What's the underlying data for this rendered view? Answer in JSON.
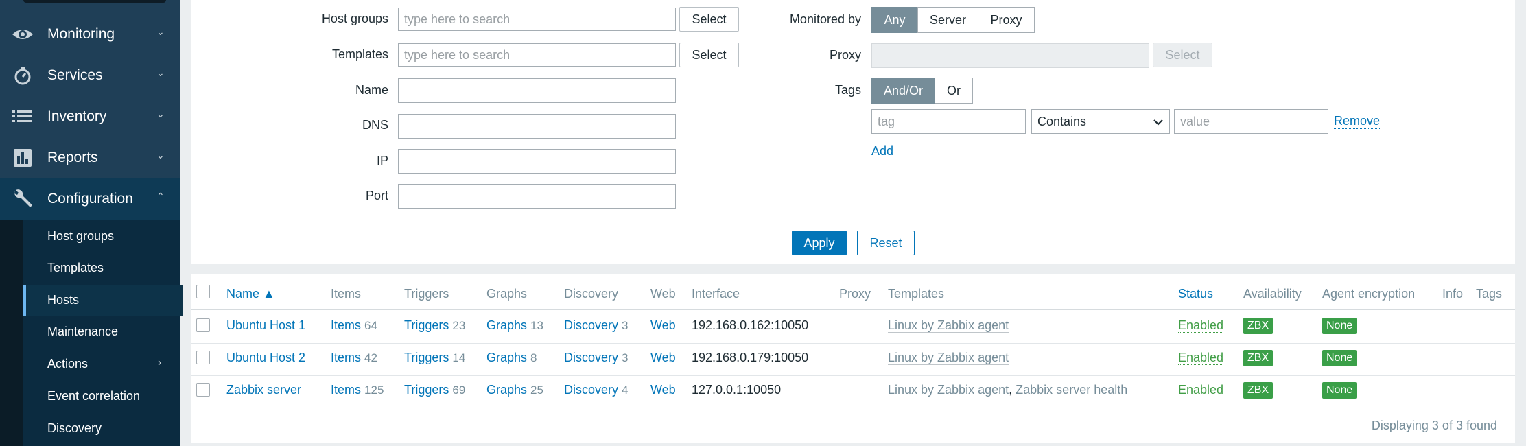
{
  "sidebar": {
    "items": [
      {
        "label": "Monitoring",
        "icon": "eye-icon",
        "chevron": "⌄"
      },
      {
        "label": "Services",
        "icon": "stopwatch-icon",
        "chevron": "⌄"
      },
      {
        "label": "Inventory",
        "icon": "list-icon",
        "chevron": "⌄"
      },
      {
        "label": "Reports",
        "icon": "bar-chart-icon",
        "chevron": "⌄"
      },
      {
        "label": "Configuration",
        "icon": "wrench-icon",
        "chevron": "⌃"
      }
    ],
    "subitems": [
      {
        "label": "Host groups"
      },
      {
        "label": "Templates"
      },
      {
        "label": "Hosts",
        "selected": true
      },
      {
        "label": "Maintenance"
      },
      {
        "label": "Actions",
        "chevron": "›"
      },
      {
        "label": "Event correlation"
      },
      {
        "label": "Discovery"
      }
    ]
  },
  "filter": {
    "host_groups": {
      "label": "Host groups",
      "placeholder": "type here to search",
      "button": "Select"
    },
    "templates": {
      "label": "Templates",
      "placeholder": "type here to search",
      "button": "Select"
    },
    "name": {
      "label": "Name",
      "value": ""
    },
    "dns": {
      "label": "DNS",
      "value": ""
    },
    "ip": {
      "label": "IP",
      "value": ""
    },
    "port": {
      "label": "Port",
      "value": ""
    },
    "monitored_by": {
      "label": "Monitored by",
      "options": [
        "Any",
        "Server",
        "Proxy"
      ],
      "selected": "Any"
    },
    "proxy": {
      "label": "Proxy",
      "button": "Select"
    },
    "tags": {
      "label": "Tags",
      "options": [
        "And/Or",
        "Or"
      ],
      "selected": "And/Or",
      "tag_placeholder": "tag",
      "operator": "Contains",
      "value_placeholder": "value",
      "remove": "Remove",
      "add": "Add"
    },
    "apply": "Apply",
    "reset": "Reset"
  },
  "table": {
    "headers": {
      "name": "Name ▲",
      "items": "Items",
      "triggers": "Triggers",
      "graphs": "Graphs",
      "discovery": "Discovery",
      "web": "Web",
      "interface": "Interface",
      "proxy": "Proxy",
      "templates": "Templates",
      "status": "Status",
      "availability": "Availability",
      "agent_encryption": "Agent encryption",
      "info": "Info",
      "tags": "Tags"
    },
    "rows": [
      {
        "name": "Ubuntu Host 1",
        "items_label": "Items",
        "items": "64",
        "triggers_label": "Triggers",
        "triggers": "23",
        "graphs_label": "Graphs",
        "graphs": "13",
        "discovery_label": "Discovery",
        "discovery": "3",
        "web": "Web",
        "interface": "192.168.0.162:10050",
        "templates": [
          "Linux by Zabbix agent"
        ],
        "status": "Enabled",
        "availability": "ZBX",
        "encryption": "None"
      },
      {
        "name": "Ubuntu Host 2",
        "items_label": "Items",
        "items": "42",
        "triggers_label": "Triggers",
        "triggers": "14",
        "graphs_label": "Graphs",
        "graphs": "8",
        "discovery_label": "Discovery",
        "discovery": "3",
        "web": "Web",
        "interface": "192.168.0.179:10050",
        "templates": [
          "Linux by Zabbix agent"
        ],
        "status": "Enabled",
        "availability": "ZBX",
        "encryption": "None"
      },
      {
        "name": "Zabbix server",
        "items_label": "Items",
        "items": "125",
        "triggers_label": "Triggers",
        "triggers": "69",
        "graphs_label": "Graphs",
        "graphs": "25",
        "discovery_label": "Discovery",
        "discovery": "4",
        "web": "Web",
        "interface": "127.0.0.1:10050",
        "templates": [
          "Linux by Zabbix agent",
          "Zabbix server health"
        ],
        "status": "Enabled",
        "availability": "ZBX",
        "encryption": "None"
      }
    ],
    "template_separator": ",",
    "footer": "Displaying 3 of 3 found"
  },
  "colors": {
    "sidebar": "#1f3f57",
    "accent": "#0275b8",
    "enabled": "#429e47",
    "badge": "#3a9f48"
  }
}
